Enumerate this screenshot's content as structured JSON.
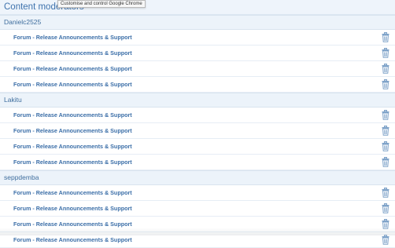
{
  "page": {
    "title": "Content moderators",
    "tooltip": "Customise and control Google Chrome"
  },
  "groups": [
    {
      "user": "Danielc2525",
      "items": [
        "Forum - Release Announcements & Support",
        "Forum - Release Announcements & Support",
        "Forum - Release Announcements & Support",
        "Forum - Release Announcements & Support"
      ]
    },
    {
      "user": "Lakitu",
      "items": [
        "Forum - Release Announcements & Support",
        "Forum - Release Announcements & Support",
        "Forum - Release Announcements & Support",
        "Forum - Release Announcements & Support"
      ]
    },
    {
      "user": "seppdemba",
      "items": [
        "Forum - Release Announcements & Support",
        "Forum - Release Announcements & Support",
        "Forum - Release Announcements & Support",
        "Forum - Release Announcements & Support"
      ]
    }
  ],
  "icons": {
    "delete": "trash-icon"
  },
  "colors": {
    "link": "#3c6fa8",
    "header_bg": "#ecf3fa",
    "icon": "#7fa3c9"
  }
}
